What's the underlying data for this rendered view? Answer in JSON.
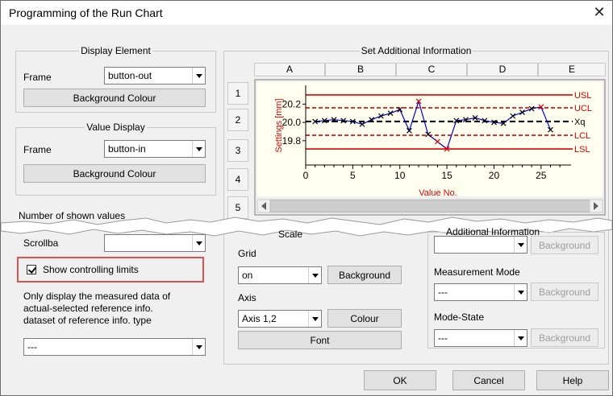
{
  "window": {
    "title": "Programming of the Run Chart",
    "close_glyph": "✕"
  },
  "display_element": {
    "legend": "Display Element",
    "frame_label": "Frame",
    "frame_value": "button-out",
    "bg_button": "Background Colour"
  },
  "value_display": {
    "legend": "Value Display",
    "frame_label": "Frame",
    "frame_value": "button-in",
    "bg_button": "Background Colour",
    "shown_values_label": "Number of shown values",
    "scrollbar_label": "Scrollba"
  },
  "controlling_limits": {
    "label": "Show controlling limits",
    "checked": true,
    "highlight_color": "#d9534f"
  },
  "reference": {
    "text1": "Only display the measured data of",
    "text2": "actual-selected reference info.",
    "text3": "dataset of reference info. type",
    "value": "---"
  },
  "additional_info": {
    "legend": "Set Additional Information",
    "columns": [
      "A",
      "B",
      "C",
      "D",
      "E"
    ],
    "rows": [
      "1",
      "2",
      "3",
      "4",
      "5"
    ]
  },
  "chart_data": {
    "type": "line",
    "ylabel": "Settings [mm]",
    "xlabel": "Value No.",
    "x_ticks": [
      "0",
      "5",
      "10",
      "15",
      "20",
      "25"
    ],
    "y_ticks": [
      "20.2",
      "20.0",
      "19.8"
    ],
    "xlim": [
      0,
      27.5
    ],
    "ylim": [
      19.57,
      20.37
    ],
    "limits": [
      {
        "name": "USL",
        "value": 20.3,
        "color": "#e00000",
        "style": "solid"
      },
      {
        "name": "UCL",
        "value": 20.16,
        "color": "#e00000",
        "style": "dashed"
      },
      {
        "name": "Xq",
        "value": 20.01,
        "color": "#000000",
        "style": "dashed"
      },
      {
        "name": "LCL",
        "value": 19.86,
        "color": "#e00000",
        "style": "dashed"
      },
      {
        "name": "LSL",
        "value": 19.71,
        "color": "#e00000",
        "style": "solid"
      }
    ],
    "x": [
      1,
      2,
      3,
      4,
      5,
      6,
      7,
      8,
      9,
      10,
      11,
      12,
      13,
      14,
      15,
      16,
      17,
      18,
      19,
      20,
      21,
      22,
      23,
      24,
      25,
      26
    ],
    "values": [
      20.01,
      20.02,
      20.03,
      20.02,
      20.01,
      19.98,
      20.03,
      20.07,
      20.1,
      20.14,
      19.91,
      20.23,
      19.87,
      19.79,
      19.71,
      20.02,
      20.03,
      20.05,
      20.02,
      20.0,
      19.99,
      20.07,
      20.11,
      20.15,
      20.17,
      19.92
    ],
    "series_color": "#0000cc",
    "out_of_limit_color": "#e00000",
    "plot_bg": "#fffff0",
    "scale_legend": "Scale"
  },
  "grid": {
    "label": "Grid",
    "value": "on",
    "bg_button": "Background"
  },
  "axis": {
    "label": "Axis",
    "value": "Axis 1,2",
    "colour_button": "Colour",
    "font_button": "Font"
  },
  "right_panel": {
    "legend": "Additional Information",
    "top_bg_button": "Background",
    "measurement_label": "Measurement Mode",
    "measurement_value": "---",
    "measurement_bg": "Background",
    "mode_label": "Mode-State",
    "mode_value": "---",
    "mode_bg": "Background"
  },
  "footer": {
    "ok": "OK",
    "cancel": "Cancel",
    "help": "Help"
  }
}
